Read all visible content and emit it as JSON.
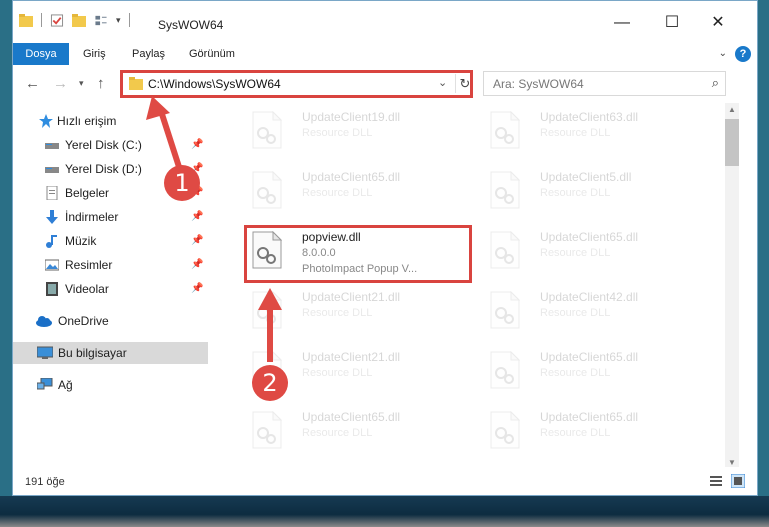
{
  "window": {
    "title": "SysWOW64"
  },
  "ribbon": {
    "tabs": [
      {
        "label": "Dosya"
      },
      {
        "label": "Giriş"
      },
      {
        "label": "Paylaş"
      },
      {
        "label": "Görünüm"
      }
    ],
    "help_label": "?"
  },
  "address": {
    "path": "C:\\Windows\\SysWOW64"
  },
  "search": {
    "placeholder": "Ara: SysWOW64"
  },
  "nav": {
    "items": [
      {
        "label": "Hızlı erişim",
        "icon": "star-icon"
      },
      {
        "label": "Yerel Disk (C:)",
        "icon": "drive-icon",
        "pinned": true
      },
      {
        "label": "Yerel Disk (D:)",
        "icon": "drive-icon",
        "pinned": true
      },
      {
        "label": "Belgeler",
        "icon": "documents-icon",
        "pinned": true
      },
      {
        "label": "İndirmeler",
        "icon": "downloads-icon",
        "pinned": true
      },
      {
        "label": "Müzik",
        "icon": "music-icon",
        "pinned": true
      },
      {
        "label": "Resimler",
        "icon": "pictures-icon",
        "pinned": true
      },
      {
        "label": "Videolar",
        "icon": "videos-icon",
        "pinned": true
      },
      {
        "label": "OneDrive",
        "icon": "cloud-icon"
      },
      {
        "label": "Bu bilgisayar",
        "icon": "computer-icon",
        "selected": true
      },
      {
        "label": "Ağ",
        "icon": "network-icon"
      }
    ]
  },
  "files": {
    "left": [
      {
        "name": "UpdateClient19.dll",
        "line1": "Resource DLL"
      },
      {
        "name": "UpdateClient65.dll",
        "line1": "Resource DLL"
      },
      {
        "name": "popview.dll",
        "line1": "8.0.0.0",
        "line2": "PhotoImpact Popup V...",
        "highlight": true
      },
      {
        "name": "UpdateClient21.dll",
        "line1": "Resource DLL"
      },
      {
        "name": "UpdateClient21.dll",
        "line1": "Resource DLL"
      },
      {
        "name": "UpdateClient65.dll",
        "line1": "Resource DLL"
      }
    ],
    "right": [
      {
        "name": "UpdateClient63.dll",
        "line1": "Resource DLL"
      },
      {
        "name": "UpdateClient5.dll",
        "line1": "Resource DLL"
      },
      {
        "name": "UpdateClient65.dll",
        "line1": "Resource DLL"
      },
      {
        "name": "UpdateClient42.dll",
        "line1": "Resource DLL"
      },
      {
        "name": "UpdateClient65.dll",
        "line1": "Resource DLL"
      },
      {
        "name": "UpdateClient65.dll",
        "line1": "Resource DLL"
      }
    ]
  },
  "status": {
    "count": "191 öğe"
  },
  "annotations": {
    "step1": "1",
    "step2": "2"
  },
  "colors": {
    "accent": "#1979ca",
    "highlight": "#d9443f"
  }
}
